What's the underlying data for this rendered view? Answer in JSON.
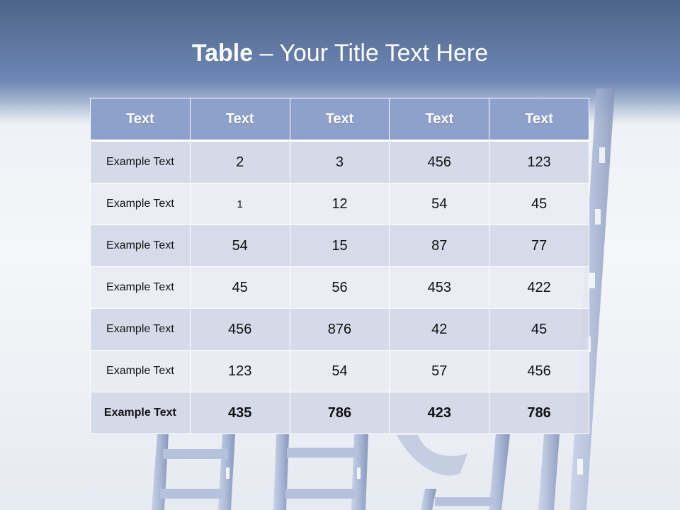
{
  "slide": {
    "title_bold": "Table",
    "title_rest": " – Your Title Text Here"
  },
  "table": {
    "headers": [
      "Text",
      "Text",
      "Text",
      "Text",
      "Text"
    ],
    "rows": [
      [
        "Example Text",
        "2",
        "3",
        "456",
        "123"
      ],
      [
        "Example Text",
        "1",
        "12",
        "54",
        "45"
      ],
      [
        "Example Text",
        "54",
        "15",
        "87",
        "77"
      ],
      [
        "Example Text",
        "45",
        "56",
        "453",
        "422"
      ],
      [
        "Example Text",
        "456",
        "876",
        "42",
        "45"
      ],
      [
        "Example Text",
        "123",
        "54",
        "57",
        "456"
      ],
      [
        "Example Text",
        "435",
        "786",
        "423",
        "786"
      ]
    ]
  },
  "colors": {
    "header_fill": "#8ea1cc",
    "title_band": "#6e87b6",
    "row_dark": "#d2d8e7",
    "row_light": "#e9ecf3"
  },
  "icons": [
    "ladder-graphic"
  ]
}
